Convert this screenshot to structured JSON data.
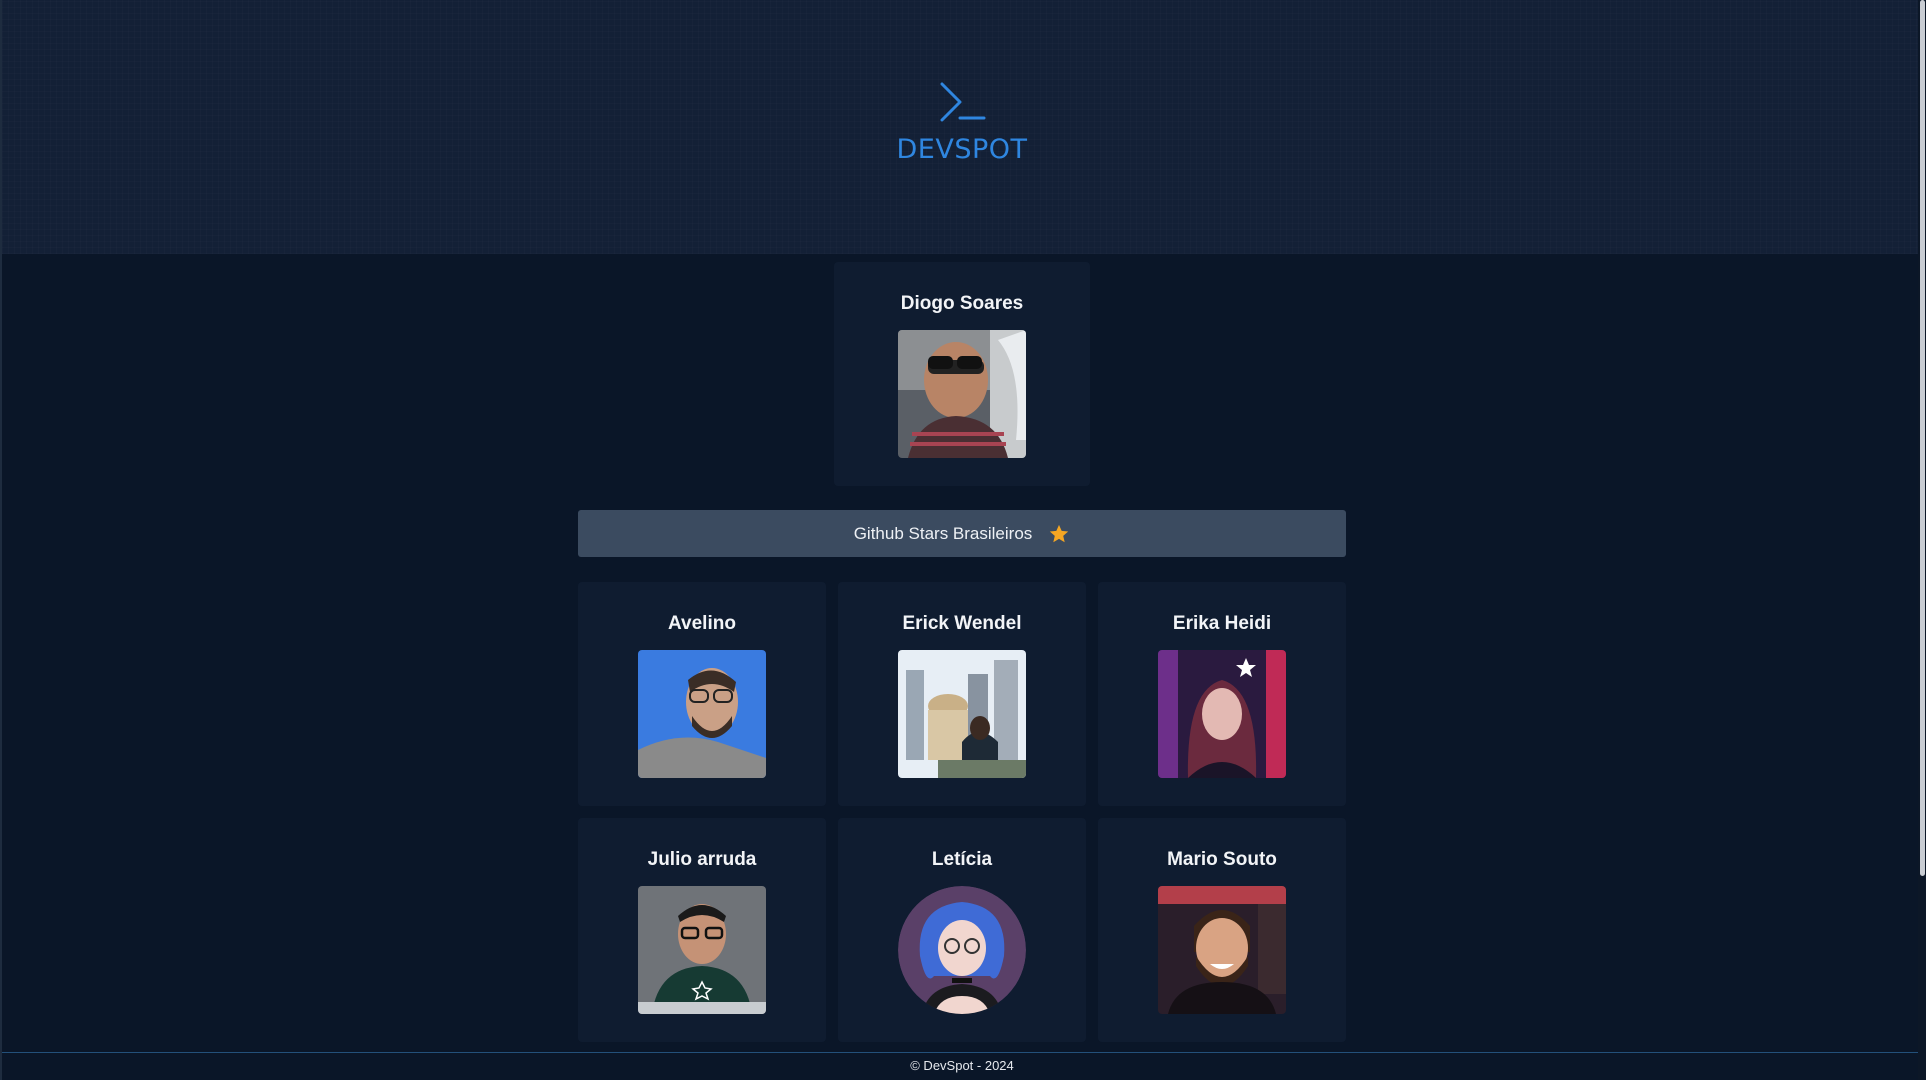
{
  "brand": {
    "logo_icon": "terminal-prompt-icon",
    "name": "DEVSPOT",
    "accent_color": "#2f86e0"
  },
  "featured": {
    "name": "Diogo Soares"
  },
  "section": {
    "title": "Github Stars Brasileiros",
    "icon": "star-icon",
    "icon_color": "#f5a623"
  },
  "members": [
    {
      "name": "Avelino"
    },
    {
      "name": "Erick Wendel"
    },
    {
      "name": "Erika Heidi"
    },
    {
      "name": "Julio arruda"
    },
    {
      "name": "Letícia"
    },
    {
      "name": "Mario Souto"
    }
  ],
  "footer": {
    "text": "© DevSpot - 2024"
  }
}
